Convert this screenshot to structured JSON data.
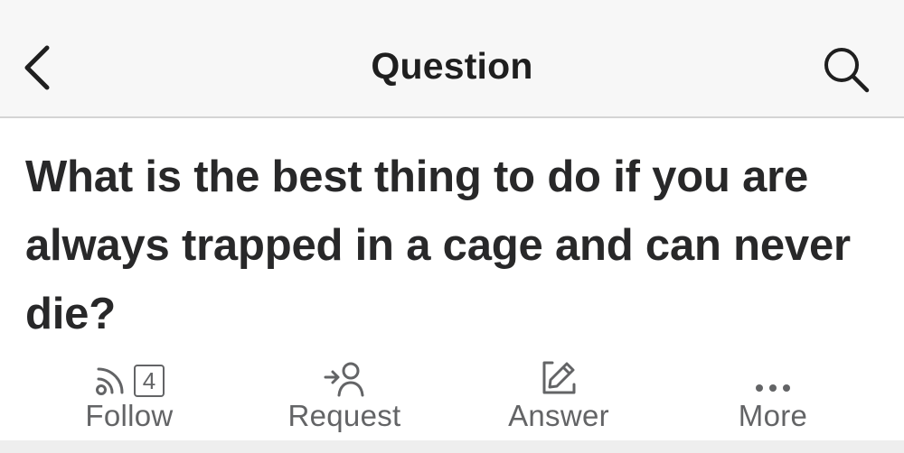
{
  "header": {
    "title": "Question",
    "back_icon": "chevron-left-icon",
    "search_icon": "search-icon"
  },
  "question": {
    "text": "What is the best thing to do if you are always trapped in a cage and can never die?"
  },
  "actions": {
    "follow": {
      "label": "Follow",
      "count": "4",
      "icon": "rss-icon"
    },
    "request": {
      "label": "Request",
      "icon": "user-arrow-icon"
    },
    "answer": {
      "label": "Answer",
      "icon": "pencil-icon"
    },
    "more": {
      "label": "More",
      "icon": "more-dots-icon"
    }
  },
  "colors": {
    "header_bg": "#f7f7f7",
    "text_primary": "#282829",
    "text_secondary": "#636466",
    "divider": "#d4d4d4"
  }
}
